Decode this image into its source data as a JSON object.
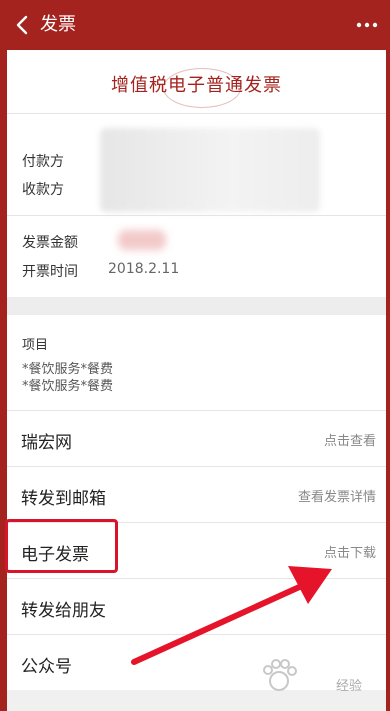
{
  "header": {
    "title": "发票",
    "back_icon": "chevron-left-icon",
    "more_icon": "more-dots-icon",
    "bar_color": "#a5231e"
  },
  "invoice": {
    "title": "增值税电子普通发票",
    "payer_label": "付款方",
    "payee_label": "收款方",
    "amount_label": "发票金额",
    "issue_time_label": "开票时间",
    "issue_time_value": "2018.2.11",
    "items_label": "项目",
    "items": [
      "*餐饮服务*餐费",
      "*餐饮服务*餐费"
    ]
  },
  "rows": [
    {
      "label": "瑞宏网",
      "action": "点击查看"
    },
    {
      "label": "转发到邮箱",
      "action": "查看发票详情"
    },
    {
      "label": "电子发票",
      "action": "点击下载"
    },
    {
      "label": "转发给朋友",
      "action": ""
    },
    {
      "label": "公众号",
      "action": ""
    }
  ],
  "annotation": {
    "highlight_color": "#d9142a"
  },
  "watermark": {
    "text": "经验"
  }
}
